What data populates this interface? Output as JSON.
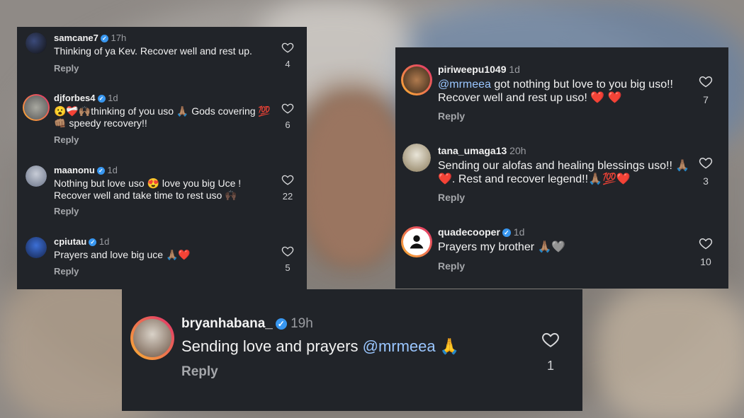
{
  "left_panel": {
    "comments": [
      {
        "username": "samcane7",
        "time": "17h",
        "text": "Thinking of ya Kev. Recover well and rest up.",
        "reply": "Reply",
        "likes": "4",
        "verified": true
      },
      {
        "username": "djforbes4",
        "time": "1d",
        "text": "😮❤️‍🩹🙌🏽thinking of you uso 🙏🏽 Gods covering 💯👊🏽 speedy recovery!!",
        "reply": "Reply",
        "likes": "6",
        "verified": true
      },
      {
        "username": "maanonu",
        "time": "1d",
        "text": "Nothing but love uso 😍 love you big Uce ! Recover well and take time to rest uso 🙌🏿",
        "reply": "Reply",
        "likes": "22",
        "verified": true
      },
      {
        "username": "cpiutau",
        "time": "1d",
        "text": "Prayers and love big uce 🙏🏽❤️",
        "reply": "Reply",
        "likes": "5",
        "verified": true
      }
    ]
  },
  "right_panel": {
    "comments": [
      {
        "username": "piriweepu1049",
        "time": "1d",
        "mention": "@mrmeea",
        "text": " got nothing but love to you big uso!! Recover well and rest up uso! ❤️ ❤️",
        "reply": "Reply",
        "likes": "7",
        "verified": false
      },
      {
        "username": "tana_umaga13",
        "time": "20h",
        "text": "Sending our alofas and healing blessings uso!! 🙏🏽❤️. Rest and recover legend!!🙏🏽💯❤️",
        "reply": "Reply",
        "likes": "3",
        "verified": false
      },
      {
        "username": "quadecooper",
        "time": "1d",
        "text": "Prayers my brother 🙏🏽🩶",
        "reply": "Reply",
        "likes": "10",
        "verified": true
      }
    ]
  },
  "bottom_panel": {
    "username": "bryanhabana_",
    "time": "19h",
    "text": "Sending love and prayers ",
    "mention": "@mrmeea",
    "emoji": " 🙏",
    "reply": "Reply",
    "likes": "1",
    "verified": true
  },
  "icons": {
    "heart": "heart-icon",
    "verified": "verified-badge-icon"
  },
  "colors": {
    "panel": "#212429",
    "verified": "#3897f0",
    "mention": "#9ac6ff",
    "story_ring": "#e1306c"
  }
}
